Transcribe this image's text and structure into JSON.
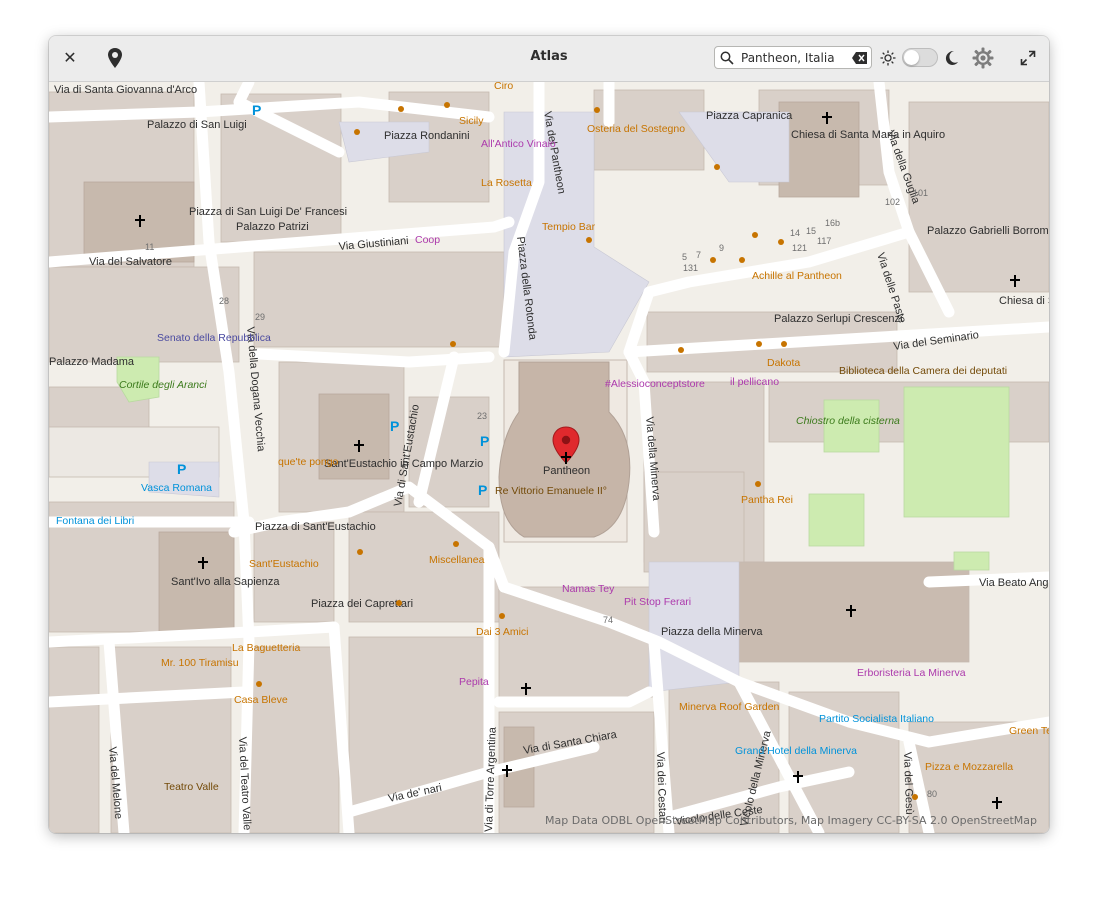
{
  "window": {
    "title": "Atlas"
  },
  "search": {
    "value": "Pantheon, Italia"
  },
  "map": {
    "attribution": "Map Data ODBL OpenStreetMap Contributors, Map Imagery CC-BY-SA 2.0 OpenStreetMap",
    "selected_place": "Pantheon",
    "streets": [
      "Via Giustiniani",
      "Via del Salvatore",
      "Via della Dogana Vecchia",
      "Via di Sant'Eustachio",
      "Via del Pantheon",
      "Piazza della Rotonda",
      "Via della Minerva",
      "Via del Seminario",
      "Via di Santa Chiara",
      "Via di Torre Argentina",
      "Via del Teatro Valle",
      "Via del Melone",
      "Via de' nari",
      "Via dei Cestari",
      "Vicolo della Minerva",
      "Vicolo delle Ceste",
      "Via delle Paste",
      "Via della Guglia",
      "Via Beato Angelico",
      "Via di Santa Giovanna d'Arco",
      "Via del Gesù"
    ],
    "squares": [
      "Piazza Rondanini",
      "Piazza Capranica",
      "Piazza di San Luigi De' Francesi",
      "Piazza di Sant'Eustachio",
      "Piazza dei Caprettari",
      "Piazza della Minerva",
      "Palazzo di San Luigi",
      "Palazzo Patrizi",
      "Palazzo Madama",
      "Palazzo Serlupi Crescenzi",
      "Palazzo Gabrielli Borromeo"
    ],
    "churches": [
      "Chiesa di Santa Maria in Aquiro",
      "Sant'Eustachio in Campo Marzio",
      "Sant'Ivo alla Sapienza",
      "Chiesa di San Macuto"
    ],
    "pois": [
      "Sicily",
      "Ciro",
      "All'Antico Vinaio",
      "La Rosetta",
      "Osteria del Sostegno",
      "Tempio Bar",
      "Achille al Pantheon",
      "Dakota",
      "il pellicano",
      "#Alessioconceptstore",
      "Biblioteca della Camera dei deputati",
      "Chiostro della cisterna",
      "Pantha Rei",
      "Re Vittorio Emanuele II°",
      "que'te pongo",
      "Sant'Eustachio",
      "Miscellanea",
      "Namas Tey",
      "Pit Stop Ferari",
      "Dai 3 Amici",
      "Pepita",
      "Mr. 100 Tiramisu",
      "La Baguetteria",
      "Casa Bleve",
      "Teatro Valle",
      "Minerva Roof Garden",
      "Grand Hotel della Minerva",
      "Partito Socialista Italiano",
      "Erboristeria La Minerva",
      "Pizza e Mozzarella",
      "Green Tea",
      "Senato della Repubblica",
      "Cortile degli Aranci",
      "Vasca Romana",
      "Fontana dei Libri",
      "Coop"
    ],
    "house_numbers": [
      "11",
      "28",
      "29",
      "23",
      "74",
      "5",
      "7",
      "9",
      "131",
      "121",
      "117",
      "14",
      "15",
      "16b",
      "101",
      "102",
      "80"
    ]
  }
}
